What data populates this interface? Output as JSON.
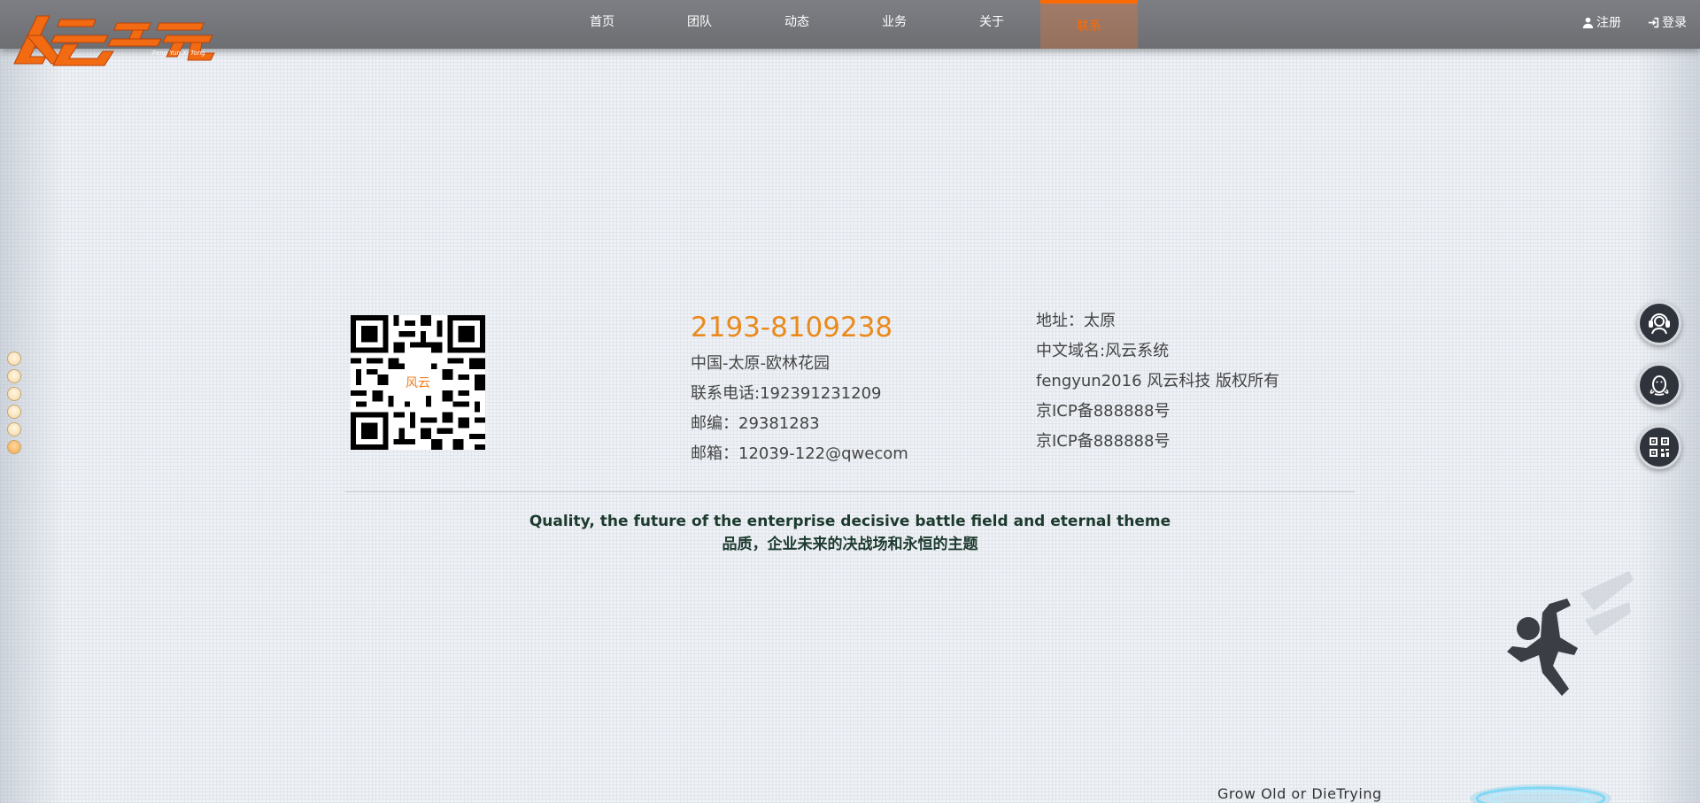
{
  "brand": {
    "logo_text": "风云系统",
    "logo_subtext": "Feng Yun Xi Tong"
  },
  "nav": {
    "items": [
      {
        "label": "首页"
      },
      {
        "label": "团队"
      },
      {
        "label": "动态"
      },
      {
        "label": "业务"
      },
      {
        "label": "关于"
      },
      {
        "label": "联系",
        "active": true
      }
    ]
  },
  "account": {
    "register_label": "注册",
    "login_label": "登录"
  },
  "pager": {
    "count": 6,
    "current_index": 5
  },
  "contact": {
    "qr_label": "风云",
    "phone": "2193-8109238",
    "address_line": "中国-太原-欧林花园",
    "tel": "联系电话:192391231209",
    "postcode": "邮编：29381283",
    "email": "邮箱：12039-122@qwecom",
    "info": {
      "address": "地址：太原",
      "domain": "中文域名:风云系统",
      "copyright": "fengyun2016 风云科技 版权所有",
      "icp1": "京ICP备888888号",
      "icp2": "京ICP备888888号"
    }
  },
  "motto": {
    "en": "Quality, the future of the enterprise decisive battle field and eternal theme",
    "zh": "品质，企业未来的决战场和永恒的主题"
  },
  "float_buttons": [
    {
      "icon": "customer-service-icon"
    },
    {
      "icon": "qq-icon"
    },
    {
      "icon": "qr-code-icon"
    }
  ],
  "slogan": "Grow Old or DieTrying",
  "colors": {
    "accent": "#ff6a00",
    "phone": "#e98a1c",
    "nav_bg": "#75777b",
    "motto": "#1d3a2e"
  }
}
